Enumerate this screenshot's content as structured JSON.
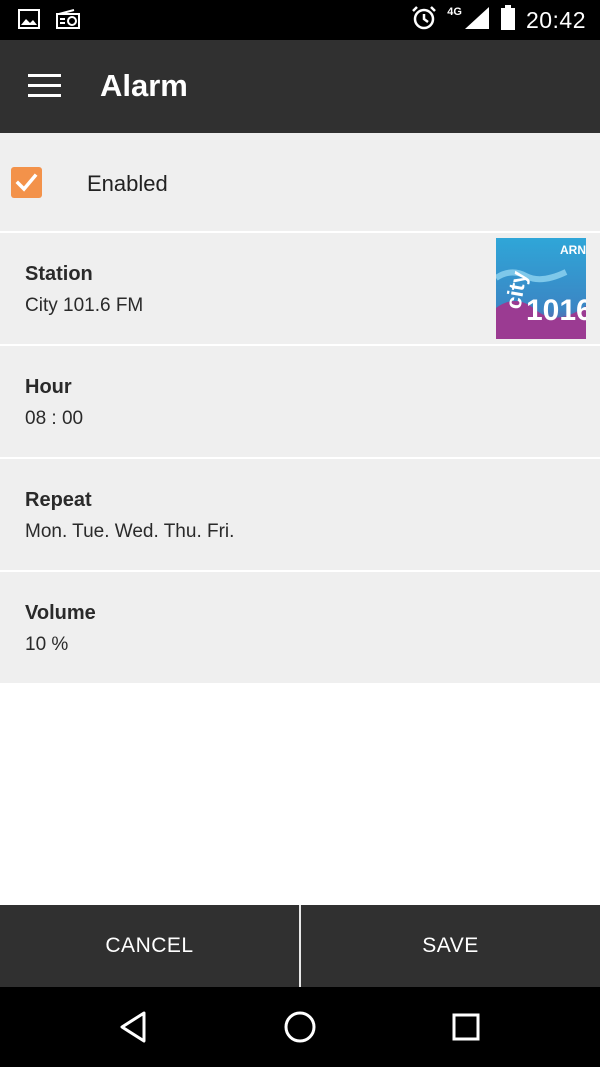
{
  "status_bar": {
    "time": "20:42",
    "network": "4G",
    "icons": [
      "image-icon",
      "radio-icon",
      "alarm-clock-icon",
      "signal-icon",
      "battery-icon"
    ]
  },
  "app_bar": {
    "title": "Alarm",
    "menu_icon": "hamburger-menu-icon"
  },
  "enabled": {
    "label": "Enabled",
    "checked": true,
    "accent_color": "#f3924a"
  },
  "settings": [
    {
      "title": "Station",
      "value": "City 101.6 FM"
    },
    {
      "title": "Hour",
      "value": "08 : 00"
    },
    {
      "title": "Repeat",
      "value": "Mon. Tue. Wed. Thu. Fri."
    },
    {
      "title": "Volume",
      "value": "10 %"
    }
  ],
  "station_logo": {
    "brand_text": "ARN",
    "wordmark": "city",
    "frequency": "1016"
  },
  "buttons": {
    "cancel": "CANCEL",
    "save": "SAVE"
  },
  "nav": {
    "icons": [
      "back-icon",
      "home-icon",
      "recents-icon"
    ]
  },
  "colors": {
    "app_bar": "#303030",
    "row_background": "#efefef",
    "checkbox": "#f3924a"
  }
}
